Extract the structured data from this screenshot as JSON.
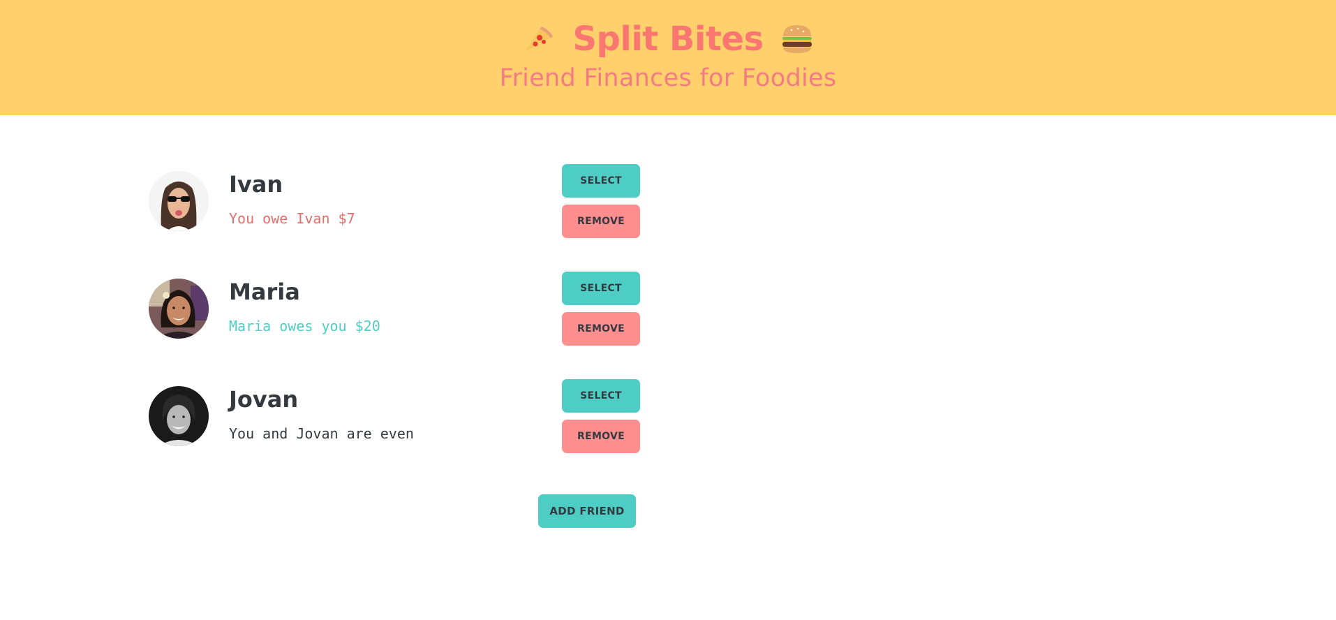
{
  "header": {
    "title": "Split Bites",
    "subtitle": "Friend Finances for Foodies",
    "left_icon": "pizza-icon",
    "right_icon": "burger-icon"
  },
  "colors": {
    "header_bg": "#ffd06b",
    "title": "#fa7670",
    "owe": "#e86b6b",
    "owed": "#4ecdc4",
    "even": "#343a40",
    "select_btn": "#4ecdc4",
    "remove_btn": "#ff8e8f"
  },
  "friends": [
    {
      "name": "Ivan",
      "balance_text": "You owe Ivan $7",
      "status": "owe"
    },
    {
      "name": "Maria",
      "balance_text": "Maria owes you $20",
      "status": "owed"
    },
    {
      "name": "Jovan",
      "balance_text": "You and Jovan are even",
      "status": "even"
    }
  ],
  "buttons": {
    "select": "SELECT",
    "remove": "REMOVE",
    "add_friend": "ADD FRIEND"
  }
}
